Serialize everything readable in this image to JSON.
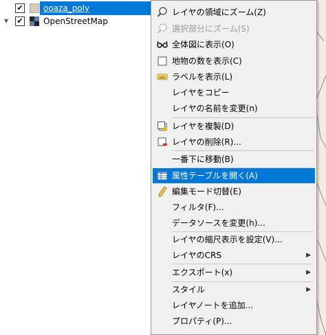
{
  "layers": [
    {
      "name": "ooaza_poly",
      "checked": true,
      "selected": true,
      "check_glyph": "✔"
    },
    {
      "name": "OpenStreetMap",
      "checked": true,
      "selected": false,
      "expand_glyph": "▼",
      "check_glyph": "✔"
    }
  ],
  "menu": {
    "items": [
      {
        "label": "レイヤの領域にズーム(Z)",
        "icon": "zoom-to-layer-icon"
      },
      {
        "label": "選択部分にズーム(S)",
        "icon": "zoom-to-selection-icon",
        "disabled": true
      },
      {
        "label": "全体図に表示(O)",
        "icon": "overview-glasses-icon"
      },
      {
        "label": "地物の数を表示(C)",
        "icon": "checkbox-icon"
      },
      {
        "label": "ラベルを表示(L)",
        "icon": "label-abc-icon"
      },
      {
        "label": "レイヤをコピー"
      },
      {
        "label": "レイヤの名前を変更(n)"
      },
      {
        "label": "レイヤを複製(D)",
        "icon": "duplicate-layer-icon"
      },
      {
        "label": "レイヤの削除(R)...",
        "icon": "remove-layer-icon"
      },
      {
        "label": "一番下に移動(B)"
      },
      {
        "label": "属性テーブルを開く(A)",
        "icon": "attribute-table-icon",
        "highlighted": true
      },
      {
        "label": "編集モード切替(E)",
        "icon": "pencil-icon"
      },
      {
        "label": "フィルタ(F)..."
      },
      {
        "label": "データソースを変更(h)..."
      },
      {
        "label": "レイヤの縮尺表示を設定(V)..."
      },
      {
        "label": "レイヤのCRS",
        "submenu": true
      },
      {
        "label": "エクスポート(x)",
        "submenu": true
      },
      {
        "label": "スタイル",
        "submenu": true
      },
      {
        "label": "レイヤノートを追加..."
      },
      {
        "label": "プロパティ(P)..."
      }
    ],
    "submenu_arrow": "▶",
    "abc_icon_text": "abc"
  },
  "colors": {
    "highlight": "#0078d7",
    "menu_bg": "#f0f0f0",
    "map_bg": "#f3ede1",
    "polygon_fill": "#d8cbb3"
  }
}
